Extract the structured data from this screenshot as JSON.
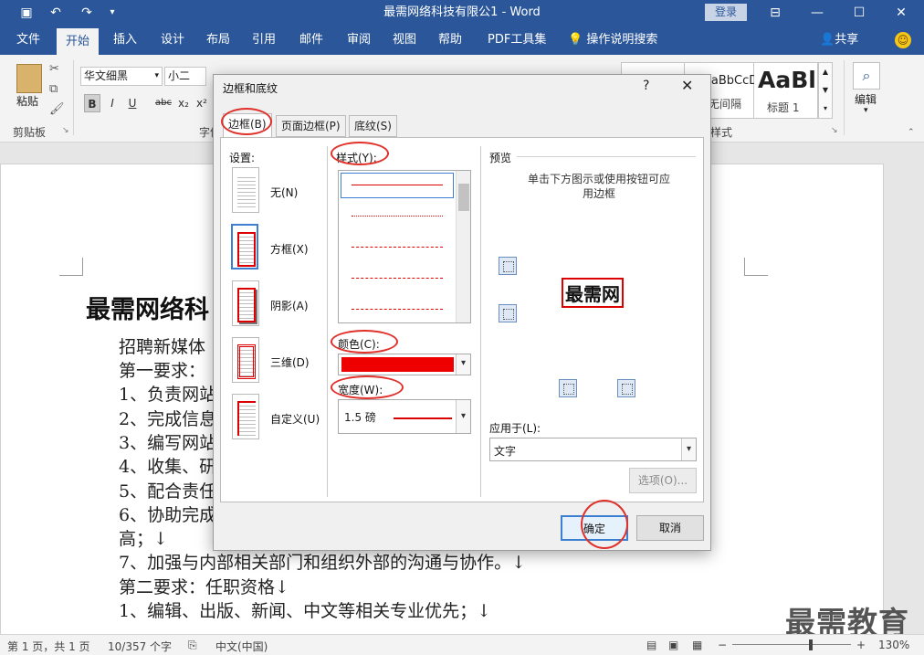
{
  "titlebar": {
    "title": "最需网络科技有限公1  -  Word",
    "login": "登录",
    "undo_icon": "↶",
    "redo_icon": "↷",
    "save_icon": "save-icon"
  },
  "tabs": [
    "文件",
    "开始",
    "插入",
    "设计",
    "布局",
    "引用",
    "邮件",
    "审阅",
    "视图",
    "帮助",
    "PDF工具集"
  ],
  "active_tab": "开始",
  "help_search": "操作说明搜索",
  "share": "共享",
  "ribbon": {
    "paste": "粘贴",
    "clipboard": "剪贴板",
    "font_name": "华文细黑",
    "font_size": "小二",
    "font_group": "字体",
    "styles": [
      "AaBbCcDc",
      "AaBl"
    ],
    "style_names": [
      "无间隔",
      "标题 1"
    ],
    "styles_group": "样式",
    "edit": "编辑"
  },
  "document": {
    "heading": "最需网络科",
    "lines": [
      "招聘新媒体",
      "第一要求：",
      "1、负责网站",
      "2、完成信息",
      "3、编写网站",
      "4、收集、研",
      "5、配合责任",
      "6、协助完成",
      "高；↓",
      "7、加强与内部相关部门和组织外部的沟通与协作。↓",
      "第二要求：任职资格↓",
      "1、编辑、出版、新闻、中文等相关专业优先；↓"
    ]
  },
  "statusbar": {
    "page": "第 1 页，共 1 页",
    "words": "10/357 个字",
    "lang": "中文(中国)",
    "zoom": "130%"
  },
  "watermark": "最需教育",
  "dialog": {
    "title": "边框和底纹",
    "help": "?",
    "tabs": [
      "边框(B)",
      "页面边框(P)",
      "底纹(S)"
    ],
    "settings_label": "设置:",
    "settings": [
      "无(N)",
      "方框(X)",
      "阴影(A)",
      "三维(D)",
      "自定义(U)"
    ],
    "style_label": "样式(Y):",
    "color_label": "颜色(C):",
    "color_value": "#ee0000",
    "width_label": "宽度(W):",
    "width_value": "1.5 磅",
    "preview_label": "预览",
    "preview_hint": "单击下方图示或使用按钮可应用边框",
    "preview_text": "最需网",
    "apply_label": "应用于(L):",
    "apply_value": "文字",
    "options_btn": "选项(O)...",
    "ok_btn": "确定",
    "cancel_btn": "取消"
  }
}
